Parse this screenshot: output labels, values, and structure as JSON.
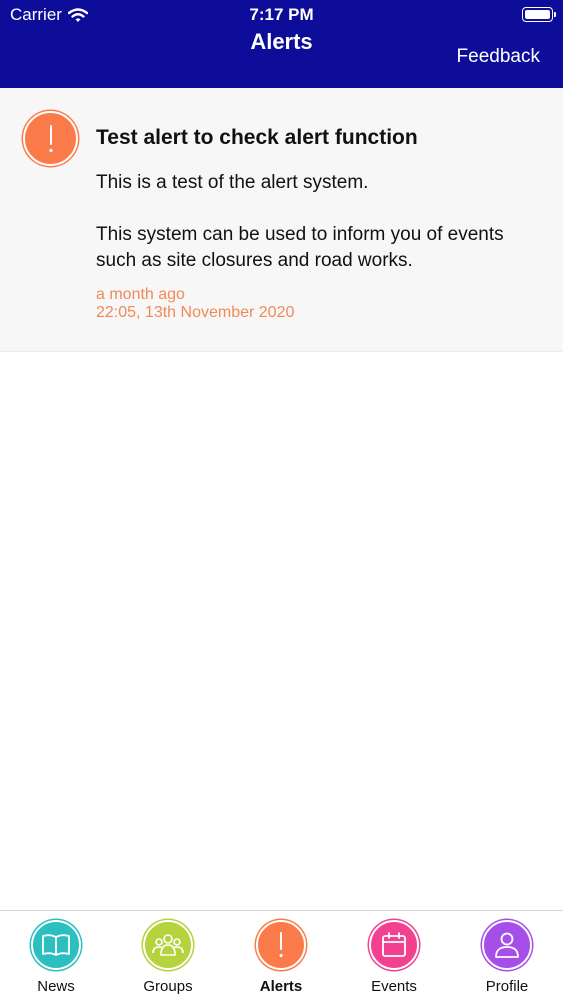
{
  "status_bar": {
    "carrier": "Carrier",
    "time": "7:17 PM"
  },
  "header": {
    "title": "Alerts",
    "feedback_label": "Feedback",
    "color": "#0d0d99"
  },
  "alert": {
    "title": "Test alert to check alert function",
    "body": [
      "This is a test of the alert system.",
      "This system can be used to inform you of events such as site closures and road works."
    ],
    "relative_time": "a month ago",
    "timestamp": "22:05, 13th November 2020",
    "icon": "exclamation-icon",
    "color": "#fb7a4a"
  },
  "tabs": [
    {
      "label": "News",
      "icon": "book-icon",
      "color": "#2bbfbf",
      "active": false
    },
    {
      "label": "Groups",
      "icon": "group-icon",
      "color": "#b4d33c",
      "active": false
    },
    {
      "label": "Alerts",
      "icon": "exclamation-icon",
      "color": "#fb7a4a",
      "active": true
    },
    {
      "label": "Events",
      "icon": "calendar-icon",
      "color": "#f2428f",
      "active": false
    },
    {
      "label": "Profile",
      "icon": "person-icon",
      "color": "#a64fe8",
      "active": false
    }
  ]
}
